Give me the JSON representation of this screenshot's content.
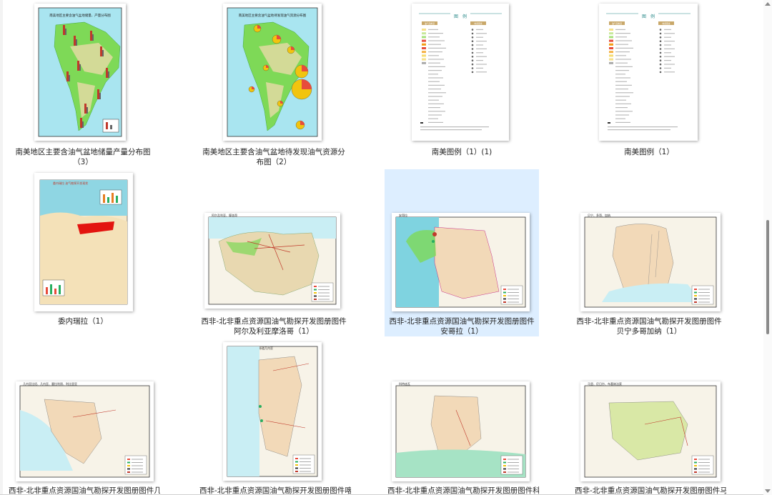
{
  "window": {
    "title": ""
  },
  "files": [
    {
      "name": "南美地区主要含油气盆地储量产量分布图（3）",
      "map_title": "南美地区主要含油气盆地储量、产量分布图",
      "thumb": "sa-production",
      "selected": false
    },
    {
      "name": "南美地区主要含油气盆地待发现油气资源分布图（2）",
      "map_title": "南美地区主要含油气盆地待发现油气资源分布图",
      "thumb": "sa-undiscovered",
      "selected": false
    },
    {
      "name": "南美图例（1）(1)",
      "map_title": "图　例",
      "thumb": "legend",
      "selected": false
    },
    {
      "name": "南美图例（1）",
      "map_title": "图　例",
      "thumb": "legend",
      "selected": false
    },
    {
      "name": "委内瑞拉（1）",
      "map_title": "委内瑞拉 油气勘探开发现状",
      "thumb": "venezuela",
      "selected": false
    },
    {
      "name": "西非-北非重点资源国油气勘探开发图册图件阿尔及利亚摩洛哥（1）",
      "map_title": "阿尔及利亚、摩洛哥",
      "thumb": "africa-north",
      "selected": false
    },
    {
      "name": "西非-北非重点资源国油气勘探开发图册图件安哥拉（1）",
      "map_title": "安哥拉",
      "thumb": "angola",
      "selected": true
    },
    {
      "name": "西非-北非重点资源国油气勘探开发图册图件贝宁多哥加纳（1）",
      "map_title": "贝宁、多哥、加纳",
      "thumb": "benin",
      "selected": false
    },
    {
      "name": "西非-北非重点资源国油气勘探开发图册图件几内",
      "map_title": "几内亚比绍、几内亚、塞拉利昂、利比里亚",
      "thumb": "guinea",
      "selected": false
    },
    {
      "name": "西非-北非重点资源国油气勘探开发图册图件喀麦",
      "map_title": "喀麦隆、加蓬、刚果、赤道几内亚",
      "thumb": "cameroon",
      "selected": false
    },
    {
      "name": "西非-北非重点资源国油气勘探开发图册图件科特",
      "map_title": "科特迪瓦",
      "thumb": "ivory",
      "selected": false
    },
    {
      "name": "西非-北非重点资源国油气勘探开发图册图件马里",
      "map_title": "马里、尼日尔、布基纳法索",
      "thumb": "mali",
      "selected": false
    }
  ],
  "legend_headers": [
    "油气田类型",
    "地质要素"
  ],
  "colors": {
    "selection": "#ddeeff",
    "land": "#f2d9b8",
    "sea": "#7fd3e0",
    "green": "#7ed957",
    "pipeline": "#c0392b"
  }
}
